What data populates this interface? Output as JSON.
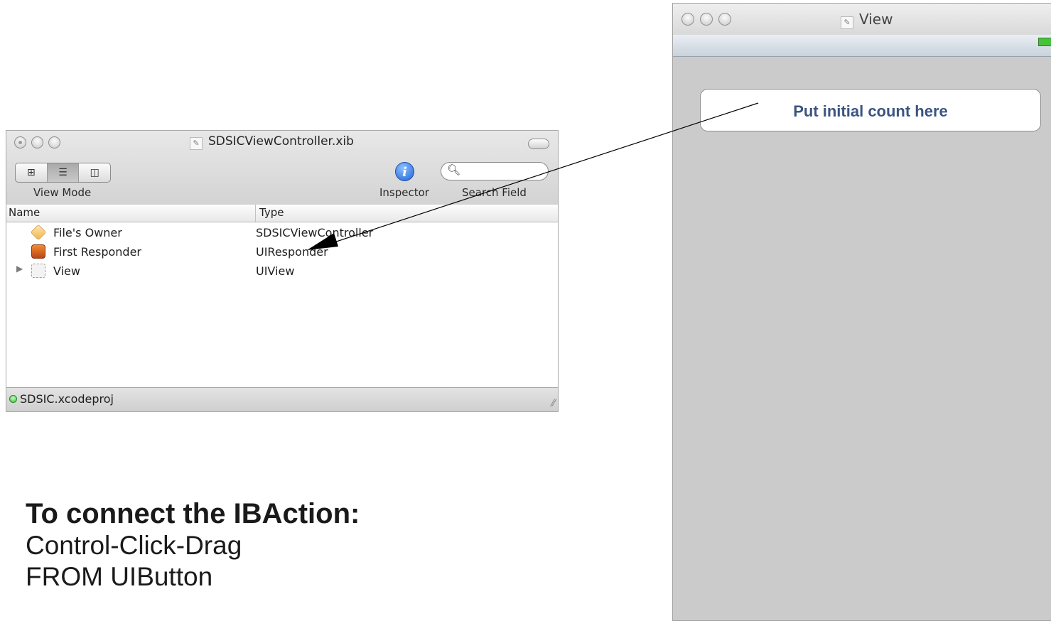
{
  "xib_window": {
    "title": "SDSICViewController.xib",
    "toolbar": {
      "view_mode_label": "View Mode",
      "view_mode_segments": [
        "icon",
        "list",
        "column"
      ],
      "view_mode_selected": "list",
      "inspector_label": "Inspector",
      "search_label": "Search Field",
      "search_value": "",
      "search_glyph": "🔍"
    },
    "columns": {
      "name": "Name",
      "type": "Type"
    },
    "rows": [
      {
        "name": "File's Owner",
        "type": "SDSICViewController",
        "icon": "files-owner-icon"
      },
      {
        "name": "First Responder",
        "type": "UIResponder",
        "icon": "first-responder-icon"
      },
      {
        "name": "View",
        "type": "UIView",
        "icon": "view-icon",
        "expandable": true
      }
    ],
    "status": {
      "project": "SDSIC.xcodeproj"
    }
  },
  "view_window": {
    "title": "View",
    "button_title": "Put initial count here"
  },
  "instructions": {
    "heading": "To connect the IBAction:",
    "lines": [
      "Control-Click-Drag",
      "FROM UIButton"
    ]
  },
  "colors": {
    "view_background": "#cbcbcb",
    "button_text": "#3b5481",
    "status_green": "#40c13a"
  }
}
